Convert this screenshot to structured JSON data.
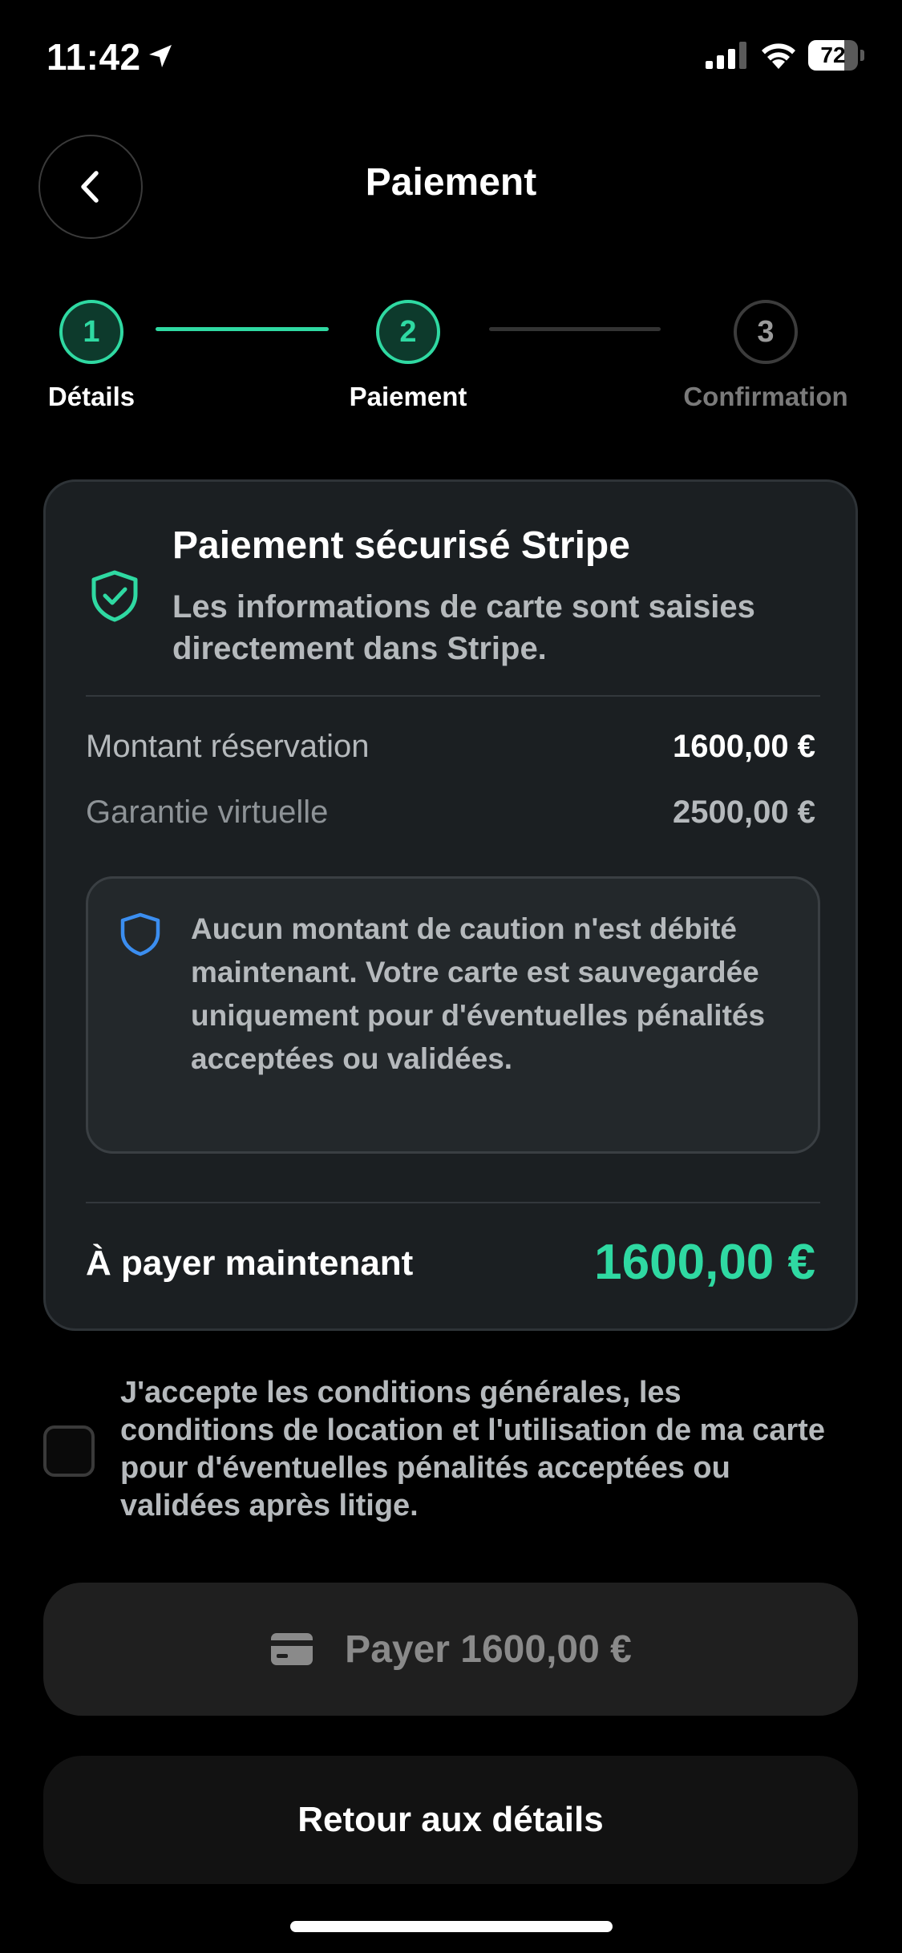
{
  "status_bar": {
    "time": "11:42",
    "battery": "72",
    "battery_level": 0.72
  },
  "header": {
    "title": "Paiement",
    "back_icon": "chevron-left-icon"
  },
  "stepper": {
    "steps": [
      {
        "number": "1",
        "label": "Détails",
        "state": "completed"
      },
      {
        "number": "2",
        "label": "Paiement",
        "state": "current"
      },
      {
        "number": "3",
        "label": "Confirmation",
        "state": "upcoming"
      }
    ]
  },
  "card": {
    "title": "Paiement sécurisé Stripe",
    "subtitle": "Les informations de carte sont saisies directement dans Stripe.",
    "rows": [
      {
        "label": "Montant réservation",
        "value": "1600,00 €"
      },
      {
        "label": "Garantie virtuelle",
        "value": "2500,00 €"
      }
    ],
    "notice": "Aucun montant de caution n'est débité maintenant. Votre carte est sauvegardée uniquement pour d'éventuelles pénalités acceptées ou validées.",
    "total_label": "À payer maintenant",
    "total_value": "1600,00 €"
  },
  "terms": {
    "text": "J'accepte les conditions générales, les conditions de location et l'utilisation de ma carte pour d'éventuelles pénalités acceptées ou validées après litige.",
    "checked": false
  },
  "actions": {
    "pay_label": "Payer 1600,00 €",
    "back_label": "Retour aux détails"
  },
  "colors": {
    "accent": "#2fd9a2",
    "notice_icon": "#3b8ef0",
    "background": "#000000",
    "card": "#1b1f22"
  }
}
